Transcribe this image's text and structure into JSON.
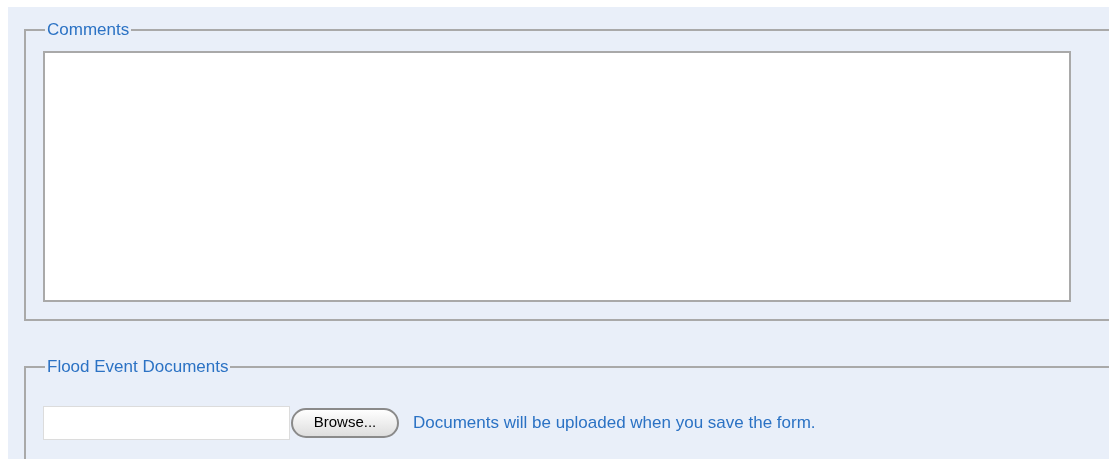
{
  "comments": {
    "legend": "Comments"
  },
  "documents": {
    "legend": "Flood Event Documents",
    "browse_button": "Browse...",
    "note": "Documents will be uploaded when you save the form."
  }
}
